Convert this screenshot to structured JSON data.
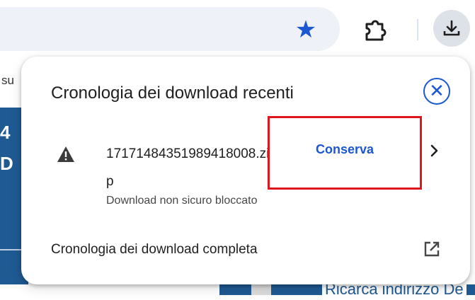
{
  "toolbar": {
    "bookmark_icon": "star-icon",
    "extensions_icon": "puzzle-icon",
    "downloads_icon": "download-icon",
    "accent_color": "#1a57d1"
  },
  "background_page": {
    "left_fragment": "su",
    "blue_fragment_1": "4",
    "blue_fragment_2": "D",
    "bottom_text": "Ricarca indirizzo De"
  },
  "download_bubble": {
    "title": "Cronologia dei download recenti",
    "close_icon": "close-circle-icon",
    "item": {
      "warning_icon": "warning-icon",
      "filename": "17171484351989418008.zip",
      "status": "Download non sicuro bloccato",
      "keep_label": "Conserva",
      "chevron_icon": "chevron-right-icon"
    },
    "full_history_label": "Cronologia dei download completa",
    "open_external_icon": "open-in-new-icon",
    "highlight_color": "#e0141d"
  }
}
